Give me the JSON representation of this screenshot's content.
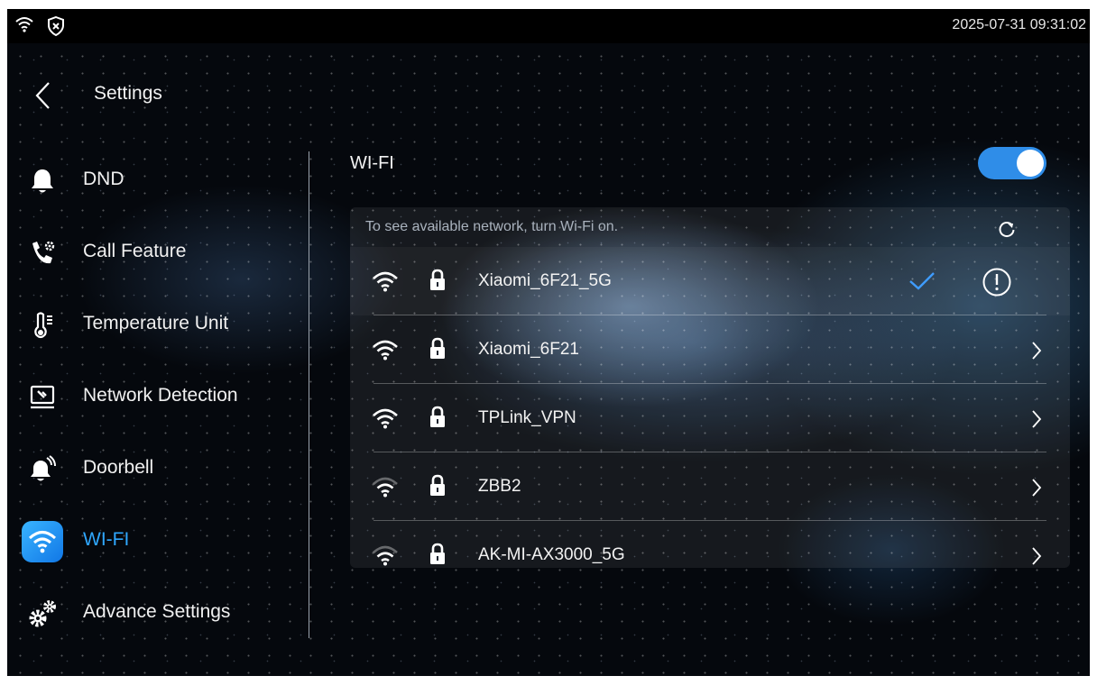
{
  "statusbar": {
    "time": "2025-07-31 09:31:02"
  },
  "header": {
    "title": "Settings"
  },
  "sidebar": {
    "items": [
      {
        "label": "DND",
        "icon": "bell-icon"
      },
      {
        "label": "Call Feature",
        "icon": "phone-gear-icon"
      },
      {
        "label": "Temperature Unit",
        "icon": "thermometer-icon"
      },
      {
        "label": "Network Detection",
        "icon": "monitor-wrench-icon"
      },
      {
        "label": "Doorbell",
        "icon": "doorbell-icon"
      },
      {
        "label": "WI-FI",
        "icon": "wifi-icon",
        "active": true
      },
      {
        "label": "Advance Settings",
        "icon": "gears-icon"
      }
    ]
  },
  "wifi": {
    "heading": "WI-FI",
    "enabled": true,
    "hint": "To see available network, turn Wi-Fi on.",
    "networks": [
      {
        "name": "Xiaomi_6F21_5G",
        "signal_bars": 3,
        "secured": true,
        "connected": true
      },
      {
        "name": "Xiaomi_6F21",
        "signal_bars": 3,
        "secured": true,
        "connected": false
      },
      {
        "name": "TPLink_VPN",
        "signal_bars": 3,
        "secured": true,
        "connected": false
      },
      {
        "name": "ZBB2",
        "signal_bars": 2,
        "secured": true,
        "connected": false
      },
      {
        "name": "AK-MI-AX3000_5G",
        "signal_bars": 2,
        "secured": true,
        "connected": false
      }
    ]
  },
  "colors": {
    "accent": "#2fa7ff",
    "toggle_on": "#2f8de8",
    "check": "#3f9cff"
  }
}
